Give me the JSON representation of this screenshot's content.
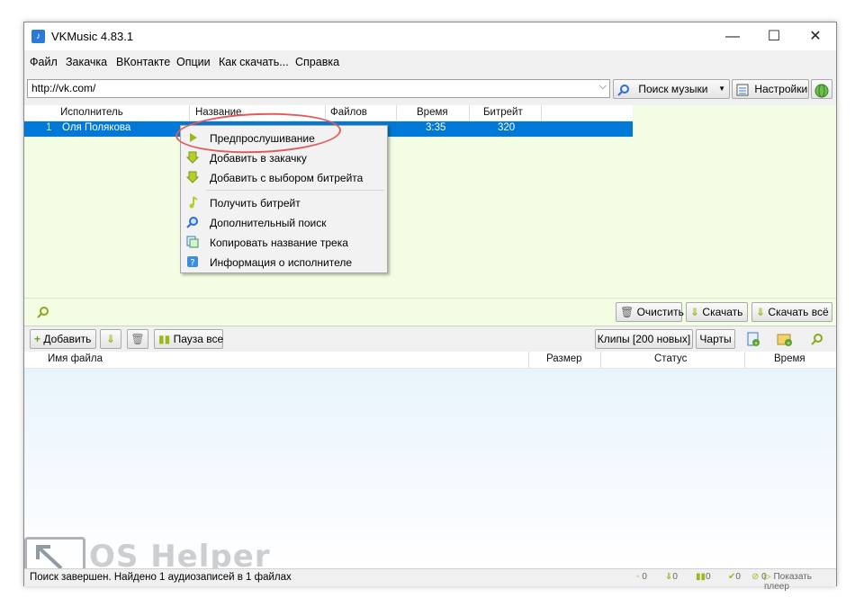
{
  "window": {
    "title": "VKMusic 4.83.1",
    "controls": {
      "minimize": "—",
      "maximize": "☐",
      "close": "✕"
    }
  },
  "menu": [
    "Файл",
    "Закачка",
    "ВКонтакте",
    "Опции",
    "Как скачать...",
    "Справка"
  ],
  "toolbar": {
    "url_value": "http://vk.com/",
    "search_mode": "Поиск музыки",
    "settings_label": "Настройки"
  },
  "results": {
    "columns": [
      "Исполнитель",
      "Название",
      "Файлов",
      "Время",
      "Битрейт"
    ],
    "rows": [
      {
        "num": "1",
        "artist": "Оля Полякова",
        "time": "3:35",
        "bitrate": "320"
      }
    ]
  },
  "context_menu": {
    "items": [
      "Предпрослушивание",
      "Добавить в закачку",
      "Добавить с выбором битрейта",
      "Получить битрейт",
      "Дополнительный поиск",
      "Копировать название трека",
      "Информация о исполнителе"
    ]
  },
  "filter_bar": {
    "clear_label": "Очистить",
    "download_label": "Скачать",
    "download_all_label": "Скачать всё"
  },
  "downloads_toolbar": {
    "add_label": "Добавить",
    "pause_all_label": "Пауза все",
    "clips_label": "Клипы [200 новых]",
    "charts_label": "Чарты"
  },
  "downloads": {
    "columns": [
      "Имя файла",
      "Размер",
      "Статус",
      "Время"
    ]
  },
  "status": {
    "message": "Поиск завершен. Найдено 1 аудиозаписей в 1 файлах",
    "counts": [
      "0",
      "0",
      "0",
      "0",
      "0"
    ],
    "show_player_label": "Показать плеер"
  },
  "watermark": {
    "text": "OS Helper"
  },
  "colors": {
    "selection": "#0078d7",
    "results_bg": "#f3fde3",
    "annotation": "#e25b5b"
  }
}
